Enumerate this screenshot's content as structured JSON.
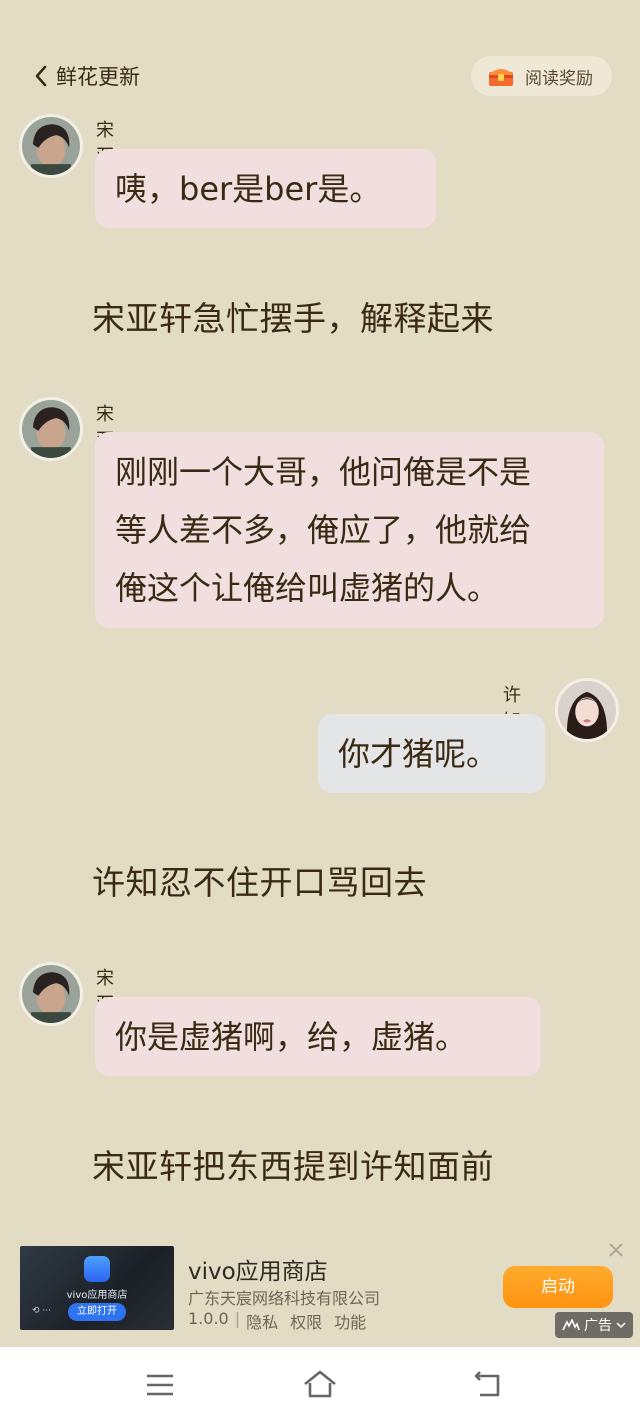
{
  "header": {
    "back_label": "鲜花更新",
    "reward_label": "阅读奖励"
  },
  "messages": [
    {
      "name": "宋亚轩",
      "lines": [
        "咦，ber是ber是。"
      ]
    },
    {
      "name": "宋亚轩",
      "lines": [
        "刚刚一个大哥，他问俺是不是",
        "等人差不多，俺应了，他就给",
        "俺这个让俺给叫虚猪的人。"
      ]
    },
    {
      "name": "许知",
      "lines": [
        "你才猪呢。"
      ]
    },
    {
      "name": "宋亚轩",
      "lines": [
        "你是虚猪啊，给，虚猪。"
      ]
    }
  ],
  "narrations": [
    "宋亚轩急忙摆手，解释起来",
    "许知忍不住开口骂回去",
    "宋亚轩把东西提到许知面前"
  ],
  "ad": {
    "thumb_store_name": "vivo应用商店",
    "thumb_open_label": "立即打开",
    "thumb_dots": "⟲ ···",
    "title": "vivo应用商店",
    "company": "广东天宸网络科技有限公司",
    "version": "1.0.0",
    "privacy": "隐私",
    "permissions": "权限",
    "features": "功能",
    "launch_label": "启动",
    "badge_label": "广告"
  },
  "icons": {
    "back": "chevron-left-icon",
    "reward": "treasure-chest-icon",
    "close": "close-icon",
    "menu": "menu-icon",
    "home": "home-icon",
    "return": "return-icon"
  },
  "colors": {
    "background": "#e2dcc5",
    "bubble_pink": "#f1dede",
    "bubble_blue": "#e3e5e6",
    "launch_button": "#ff9c1e"
  }
}
